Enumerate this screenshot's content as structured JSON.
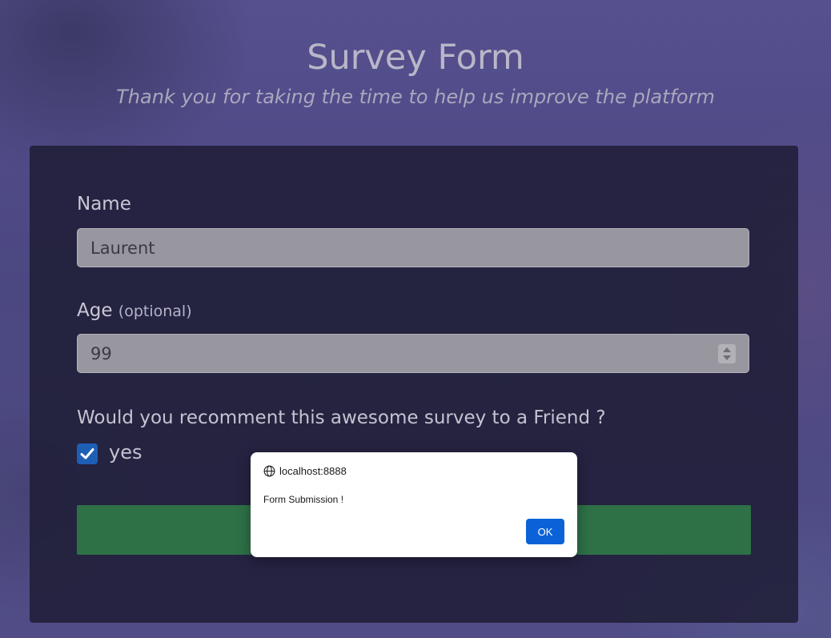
{
  "header": {
    "title": "Survey Form",
    "subtitle": "Thank you for taking the time to help us improve the platform"
  },
  "form": {
    "name": {
      "label": "Name",
      "value": "Laurent"
    },
    "age": {
      "label": "Age",
      "optional_label": "(optional)",
      "value": "99"
    },
    "recommend": {
      "question": "Would you recomment this awesome survey to a Friend ?",
      "option_label": "yes",
      "checked": true
    },
    "submit_color": "#2e7147"
  },
  "dialog": {
    "origin": "localhost:8888",
    "message": "Form Submission !",
    "ok_label": "OK",
    "icon": "globe-icon"
  },
  "colors": {
    "checkbox": "#1e5fb6",
    "ok_button": "#0b62d8",
    "card": "#1e1d36"
  }
}
